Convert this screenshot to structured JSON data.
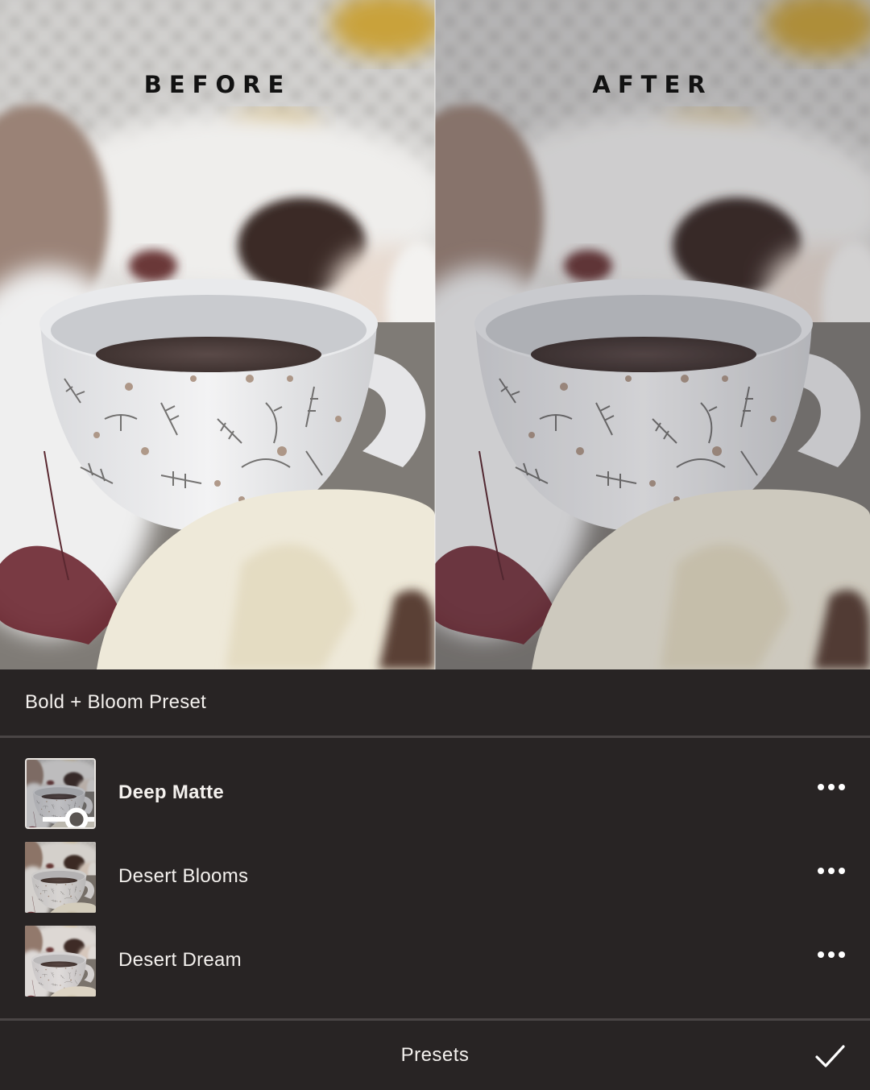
{
  "comparison": {
    "before_label": "BEFORE",
    "after_label": "AFTER"
  },
  "preset_panel": {
    "group_title": "Bold + Bloom Preset",
    "presets": [
      {
        "name": "Deep Matte",
        "selected": true,
        "thumb_icon": "adjust-sliders-icon",
        "more_icon": "more-dots-icon"
      },
      {
        "name": "Desert Blooms",
        "selected": false,
        "more_icon": "more-dots-icon"
      },
      {
        "name": "Desert Dream",
        "selected": false,
        "more_icon": "more-dots-icon"
      }
    ]
  },
  "footer": {
    "title": "Presets",
    "confirm_icon": "checkmark-icon"
  },
  "colors": {
    "panel_background": "#282424",
    "separator": "#4a4545",
    "text": "#f4f1ee"
  }
}
